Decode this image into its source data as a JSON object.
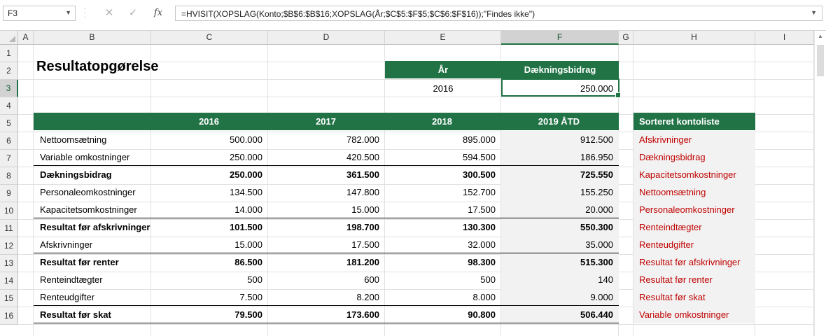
{
  "formula_bar": {
    "name_box": "F3",
    "cancel_glyph": "✕",
    "enter_glyph": "✓",
    "fx_label": "fx",
    "formula": "=HVISIT(XOPSLAG(Konto;$B$6:$B$16;XOPSLAG(År;$C$5:$F$5;$C$6:$F$16));\"Findes ikke\")"
  },
  "columns": [
    "A",
    "B",
    "C",
    "D",
    "E",
    "F",
    "G",
    "H",
    "I"
  ],
  "selected_column": "F",
  "rows": [
    "1",
    "2",
    "3",
    "4",
    "5",
    "6",
    "7",
    "8",
    "9",
    "10",
    "11",
    "12",
    "13",
    "14",
    "15",
    "16"
  ],
  "selected_row": "3",
  "sheet": {
    "title": "Resultatopgørelse",
    "lookup": {
      "year_header": "År",
      "value_header": "Dækningsbidrag",
      "year_value": "2016",
      "result_value": "250.000"
    },
    "table": {
      "headers": [
        "2016",
        "2017",
        "2018",
        "2019 ÅTD"
      ],
      "rows": [
        {
          "label": "Nettoomsætning",
          "bold": false,
          "border": false,
          "values": [
            "500.000",
            "782.000",
            "895.000",
            "912.500"
          ]
        },
        {
          "label": "Variable omkostninger",
          "bold": false,
          "border": true,
          "values": [
            "250.000",
            "420.500",
            "594.500",
            "186.950"
          ]
        },
        {
          "label": "Dækningsbidrag",
          "bold": true,
          "border": false,
          "values": [
            "250.000",
            "361.500",
            "300.500",
            "725.550"
          ]
        },
        {
          "label": "Personaleomkostninger",
          "bold": false,
          "border": false,
          "values": [
            "134.500",
            "147.800",
            "152.700",
            "155.250"
          ]
        },
        {
          "label": "Kapacitetsomkostninger",
          "bold": false,
          "border": true,
          "values": [
            "14.000",
            "15.000",
            "17.500",
            "20.000"
          ]
        },
        {
          "label": "Resultat før afskrivninger",
          "bold": true,
          "border": false,
          "values": [
            "101.500",
            "198.700",
            "130.300",
            "550.300"
          ]
        },
        {
          "label": "Afskrivninger",
          "bold": false,
          "border": true,
          "values": [
            "15.000",
            "17.500",
            "32.000",
            "35.000"
          ]
        },
        {
          "label": "Resultat før renter",
          "bold": true,
          "border": false,
          "values": [
            "86.500",
            "181.200",
            "98.300",
            "515.300"
          ]
        },
        {
          "label": "Renteindtægter",
          "bold": false,
          "border": false,
          "values": [
            "500",
            "600",
            "500",
            "140"
          ]
        },
        {
          "label": "Renteudgifter",
          "bold": false,
          "border": true,
          "values": [
            "7.500",
            "8.200",
            "8.000",
            "9.000"
          ]
        },
        {
          "label": "Resultat før skat",
          "bold": true,
          "border": true,
          "values": [
            "79.500",
            "173.600",
            "90.800",
            "506.440"
          ]
        }
      ]
    },
    "sorted_list": {
      "header": "Sorteret kontoliste",
      "items": [
        "Afskrivninger",
        "Dækningsbidrag",
        "Kapacitetsomkostninger",
        "Nettoomsætning",
        "Personaleomkostninger",
        "Renteindtægter",
        "Renteudgifter",
        "Resultat før afskrivninger",
        "Resultat før renter",
        "Resultat før skat",
        "Variable omkostninger"
      ]
    }
  },
  "colors": {
    "accent": "#217346",
    "list_text": "#c00000",
    "shade": "#f2f2f2"
  }
}
